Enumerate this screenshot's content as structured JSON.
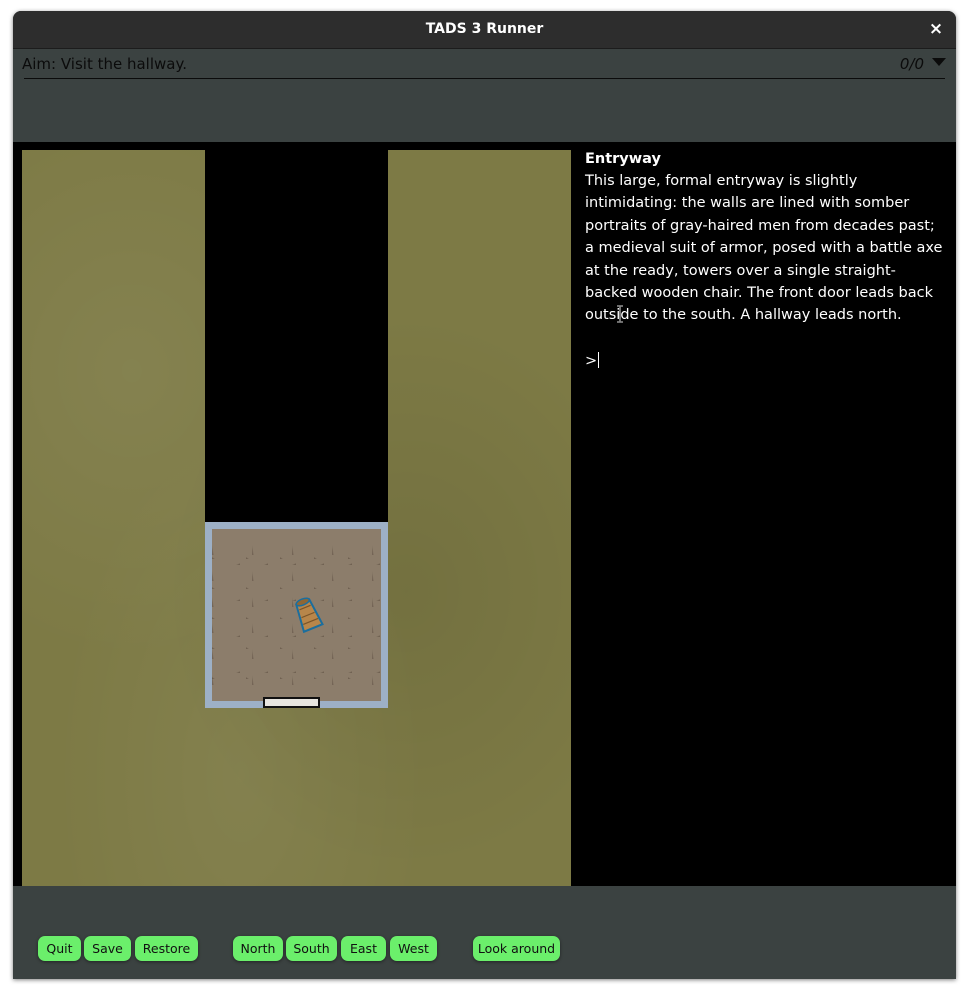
{
  "window": {
    "title": "TADS 3 Runner",
    "close_glyph": "×"
  },
  "aim": {
    "text": "Aim: Visit the hallway.",
    "score": "0/0"
  },
  "room": {
    "name": "Entryway",
    "description": "This large, formal entryway is slightly intimidating: the walls are lined with somber portraits of gray-haired men from decades past; a medieval suit of armor, posed with a battle axe at the ready, towers over a single straight-backed wooden chair.  The front door leads back outside to the south.  A hallway leads north.",
    "prompt": ">"
  },
  "buttons": {
    "quit": "Quit",
    "save": "Save",
    "restore": "Restore",
    "north": "North",
    "south": "South",
    "east": "East",
    "west": "West",
    "look": "Look around"
  },
  "colors": {
    "window_bg": "#3b4241",
    "titlebar": "#2d2d2d",
    "grass": "#7d7a45",
    "button": "#6bef6b",
    "room_border": "#9db0c6"
  }
}
